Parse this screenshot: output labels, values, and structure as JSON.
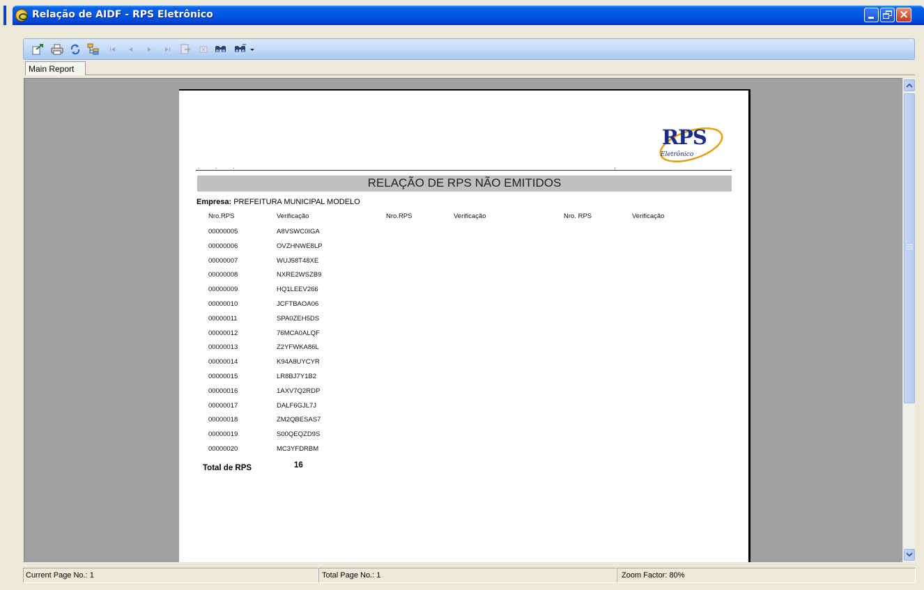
{
  "window": {
    "title": "Relação de AIDF - RPS Eletrônico"
  },
  "toolbar": {
    "tools": [
      {
        "name": "export-icon"
      },
      {
        "name": "print-icon"
      },
      {
        "name": "refresh-icon"
      },
      {
        "name": "group-tree-icon"
      },
      {
        "name": "first-page-icon"
      },
      {
        "name": "previous-page-icon"
      },
      {
        "name": "next-page-icon"
      },
      {
        "name": "last-page-icon"
      },
      {
        "name": "go-to-page-icon"
      },
      {
        "name": "stop-icon"
      },
      {
        "name": "search-text-icon"
      },
      {
        "name": "zoom-icon"
      }
    ]
  },
  "tabs": {
    "main_report": "Main Report"
  },
  "report": {
    "logo_text": "RPS",
    "logo_sub": "Eletrônico",
    "header_marks": ". . .",
    "title": "RELAÇÃO DE RPS NÃO EMITIDOS",
    "empresa_label": "Empresa:",
    "empresa_value": "PREFEITURA MUNICIPAL MODELO",
    "columns": {
      "nro_rps_1": "Nro.RPS",
      "verificacao_1": "Verificação",
      "nro_rps_2": "Nro.RPS",
      "verificacao_2": "Verificação",
      "nro_rps_3": "Nro. RPS",
      "verificacao_3": "Verificação"
    },
    "rows": [
      {
        "nro": "00000005",
        "ver": "A8VSWC0IGA"
      },
      {
        "nro": "00000006",
        "ver": "OVZHNWE8LP"
      },
      {
        "nro": "00000007",
        "ver": "WUJ58T48XE"
      },
      {
        "nro": "00000008",
        "ver": "NXRE2WSZB9"
      },
      {
        "nro": "00000009",
        "ver": "HQ1LEEV266"
      },
      {
        "nro": "00000010",
        "ver": "JCFTBAOA06"
      },
      {
        "nro": "00000011",
        "ver": "SPA0ZEH5DS"
      },
      {
        "nro": "00000012",
        "ver": "76MCA0ALQF"
      },
      {
        "nro": "00000013",
        "ver": "Z2YFWKA86L"
      },
      {
        "nro": "00000014",
        "ver": "K94A8UYCYR"
      },
      {
        "nro": "00000015",
        "ver": "LR8BJ7Y1B2"
      },
      {
        "nro": "00000016",
        "ver": "1AXV7Q2RDP"
      },
      {
        "nro": "00000017",
        "ver": "DALF6GJL7J"
      },
      {
        "nro": "00000018",
        "ver": "ZM2QBESAS7"
      },
      {
        "nro": "00000019",
        "ver": "S00QEQZD9S"
      },
      {
        "nro": "00000020",
        "ver": "MC3YFDRBM"
      }
    ],
    "total_label": "Total de RPS",
    "total_value": "16"
  },
  "status": {
    "current_page": "Current Page No.: 1",
    "total_pages": "Total Page No.: 1",
    "zoom": "Zoom Factor: 80%"
  }
}
